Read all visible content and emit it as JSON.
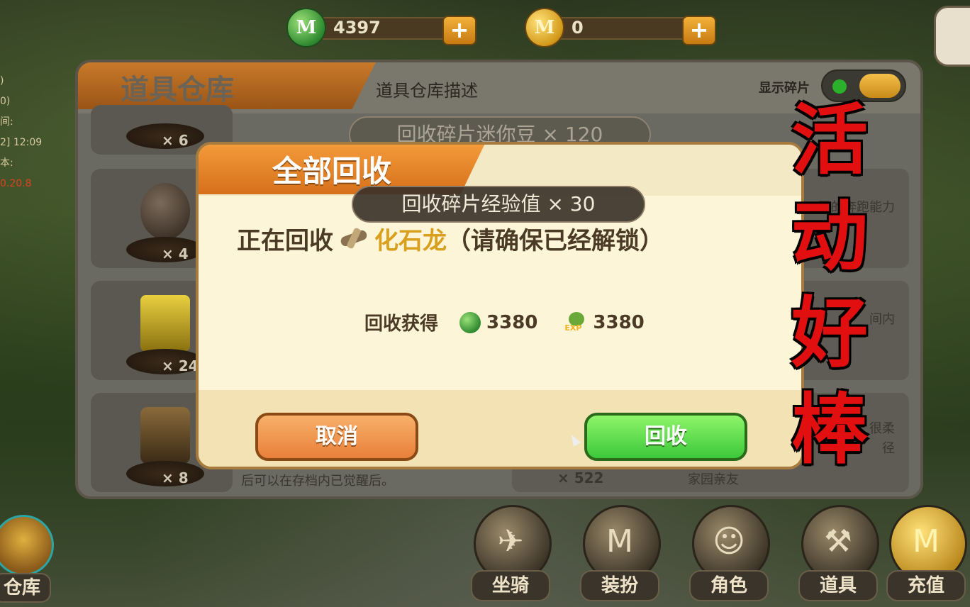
{
  "currency": {
    "gems": {
      "icon": "green-m-coin-icon",
      "coin_letter": "M",
      "value": "4397"
    },
    "coins": {
      "icon": "gold-m-coin-icon",
      "coin_letter": "M",
      "value": "0"
    },
    "plus": "+"
  },
  "left_info": {
    "line1": ")",
    "line2": "0)",
    "line3": "间:",
    "line4": "2] 12:09",
    "line5": "本:",
    "version": "0.20.8"
  },
  "warehouse": {
    "title": "道具仓库",
    "description": "道具仓库描述",
    "show_fragments_label": "显示碎片",
    "slots": [
      {
        "qty": "× 6"
      },
      {
        "qty": "× 4"
      },
      {
        "qty": "× 24"
      },
      {
        "qty": "× 8"
      }
    ],
    "right_snippets": [
      "跟的奔跑能力",
      "间内",
      "很柔",
      "径",
      "家园亲友"
    ],
    "right_qty": "× 522",
    "left_snippet": "后可以在存档内已觉醒后。"
  },
  "toasts": {
    "faded": "回收碎片迷你豆 × 120",
    "active": "回收碎片经验值 × 30"
  },
  "dialog": {
    "title": "全部回收",
    "recycling_prefix": "正在回收",
    "item_name": "化石龙",
    "recycling_suffix": "（请确保已经解锁）",
    "reward_label": "回收获得",
    "reward_gems": "3380",
    "reward_exp": "3380",
    "exp_tag": "EXP",
    "cancel_label": "取消",
    "confirm_label": "回收"
  },
  "overlay_text": [
    "活",
    "动",
    "好",
    "棒"
  ],
  "nav": {
    "warehouse": "仓库",
    "items": [
      {
        "label": "坐骑",
        "icon": "mount-icon",
        "glyph": "✈"
      },
      {
        "label": "装扮",
        "icon": "outfit-icon",
        "glyph": "M"
      },
      {
        "label": "角色",
        "icon": "character-icon",
        "glyph": "☺"
      },
      {
        "label": "道具",
        "icon": "shovel-icon",
        "glyph": "⚒"
      },
      {
        "label": "充值",
        "icon": "recharge-coin-icon",
        "glyph": "M"
      }
    ]
  }
}
